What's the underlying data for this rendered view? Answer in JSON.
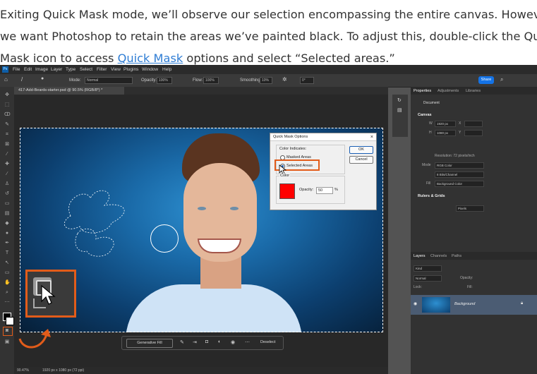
{
  "article": {
    "line1": "Exiting Quick Mask mode, we’ll observe our selection encompassing the entire canvas. However,",
    "line2": "we want Photoshop to retain the areas we’ve painted black. To adjust this, double-click the Quick",
    "line3_pre": "Mask icon to access ",
    "line3_link": "Quick Mask",
    "line3_post": " options and select “Selected areas.”"
  },
  "menubar": {
    "logo": "Ps",
    "items": [
      "File",
      "Edit",
      "Image",
      "Layer",
      "Type",
      "Select",
      "Filter",
      "View",
      "Plugins",
      "Window",
      "Help"
    ]
  },
  "optbar": {
    "mode_label": "Mode:",
    "mode_value": "Normal",
    "opacity_label": "Opacity:",
    "opacity_value": "100%",
    "flow_label": "Flow:",
    "flow_value": "100%",
    "smoothing_label": "Smoothing:",
    "smoothing_value": "10%",
    "angle_value": "0°",
    "share_label": "Share"
  },
  "document": {
    "tab_title": "417-Add-Beards-starter.psd @ 90.5% (RGB/8*) *",
    "zoom": "90.47%",
    "info": "1920 px x 1080 px (72 ppi)"
  },
  "context_bar": {
    "generative_fill": "Generative Fill",
    "deselect": "Deselect"
  },
  "dialog": {
    "title": "Quick Mask Options",
    "color_indicates": "Color Indicates:",
    "masked_areas": "Masked Areas",
    "selected_areas": "Selected Areas",
    "color_label": "Color",
    "opacity_label": "Opacity:",
    "opacity_value": "50",
    "opacity_unit": "%",
    "ok": "OK",
    "cancel": "Cancel",
    "swatch_color": "#ff0000"
  },
  "properties": {
    "tabs": [
      "Properties",
      "Adjustments",
      "Libraries"
    ],
    "doc_label": "Document",
    "canvas_title": "Canvas",
    "w_label": "W",
    "w_value": "1920 px",
    "h_label": "H",
    "h_value": "1080 px",
    "x_label": "X",
    "y_label": "Y",
    "resolution": "Resolution: 72 pixels/inch",
    "mode_label": "Mode",
    "mode_value": "RGB Color",
    "depth_value": "8 Bits/Channel",
    "fill_label": "Fill",
    "fill_value": "Background Color",
    "rulers_title": "Rulers & Grids",
    "units_value": "Pixels"
  },
  "layers": {
    "tabs": [
      "Layers",
      "Channels",
      "Paths"
    ],
    "kind_label": "Kind",
    "blend_mode": "Normal",
    "opacity_label": "Opacity:",
    "lock_label": "Lock:",
    "fill_label": "Fill:",
    "layer_name": "Background"
  },
  "colors": {
    "accent": "#e25c1a",
    "link": "#2f7dd4",
    "share_blue": "#1473e6"
  }
}
